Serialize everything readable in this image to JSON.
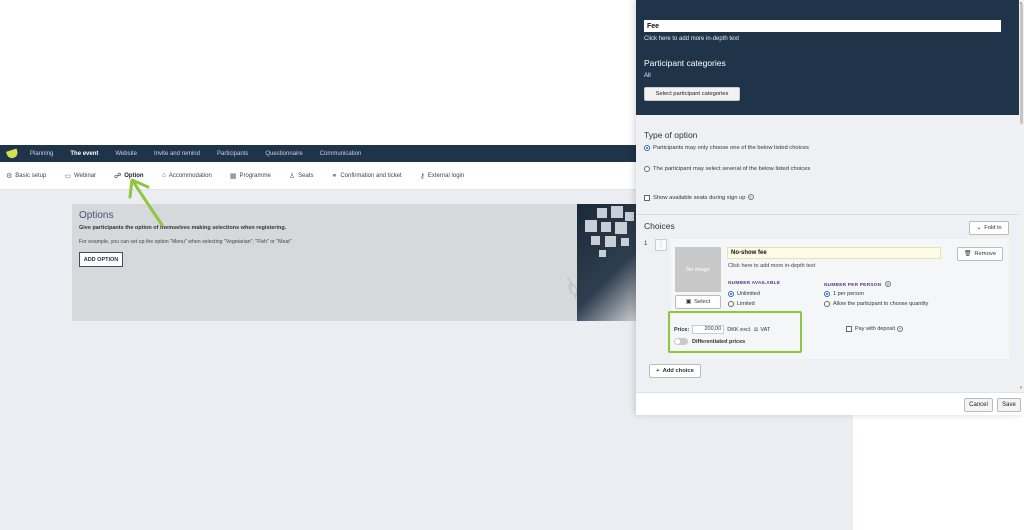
{
  "topnav": {
    "items": [
      "Planning",
      "The event",
      "Website",
      "Invite and remind",
      "Participants",
      "Questionnaire",
      "Communication"
    ]
  },
  "subnav": {
    "items": [
      {
        "label": "Basic setup",
        "icon": "gear-icon"
      },
      {
        "label": "Webinar",
        "icon": "video-icon"
      },
      {
        "label": "Option",
        "icon": "people-icon"
      },
      {
        "label": "Accommodation",
        "icon": "bed-icon"
      },
      {
        "label": "Programme",
        "icon": "calendar-icon"
      },
      {
        "label": "Seats",
        "icon": "person-icon"
      },
      {
        "label": "Confirmation and ticket",
        "icon": "link-icon"
      },
      {
        "label": "External login",
        "icon": "key-icon"
      }
    ]
  },
  "options_panel": {
    "title": "Options",
    "description": "Give participants the option of themselves making selections when registering.",
    "example": "For example, you can set up the option \"Menu\" when selecting \"Vegetarian\", \"Fish\" or \"Meat\"",
    "add_button": "ADD OPTION"
  },
  "modal": {
    "fee_value": "Fee",
    "fee_hint": "Click here to add more in-depth text",
    "participant_categories_title": "Participant categories",
    "participant_categories_value": "All",
    "select_categories_button": "Select participant categories",
    "type_title": "Type of option",
    "type_options": [
      "Participants may only choose one of the below listed choices",
      "The participant may select several of the below listed choices"
    ],
    "show_seats_label": "Show available seats during sign up",
    "choices_title": "Choices",
    "fold_button": "Fold in",
    "choice": {
      "number": "1",
      "no_image": "No image",
      "select_button": "Select",
      "name": "No-show fee",
      "hint": "Click here to add more in-depth text",
      "remove_button": "Remove",
      "number_available_label": "NUMBER AVAILABLE",
      "number_available_options": [
        "Unlimited",
        "Limited"
      ],
      "number_per_person_label": "NUMBER PER PERSON",
      "number_per_person_options": [
        "1 per person",
        "Allow the participant to choose quantity"
      ],
      "price_label": "Price:",
      "price_value": "200,00",
      "currency": "DKK excl.",
      "vat_label": "VAT",
      "differentiated_label": "Differentiated prices",
      "deposit_label": "Pay with deposit"
    },
    "add_choice_button": "Add choice",
    "cancel_button": "Cancel",
    "save_button": "Save"
  },
  "colors": {
    "navy": "#1f3349",
    "highlight_green": "#8dc63f",
    "accent_purple": "#5b3a86"
  }
}
